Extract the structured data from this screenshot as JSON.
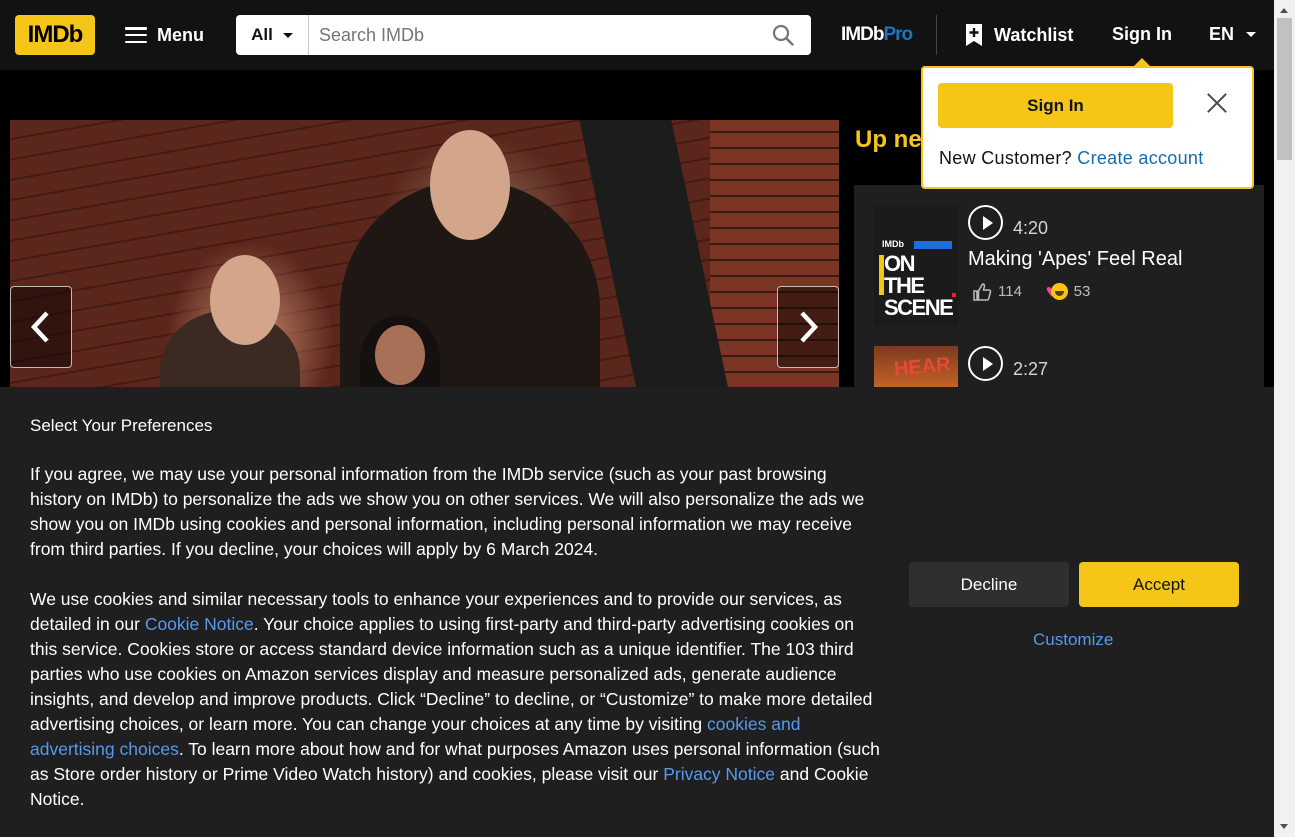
{
  "header": {
    "logo": "IMDb",
    "menu_label": "Menu",
    "search_category": "All",
    "search_placeholder": "Search IMDb",
    "imdbpro_a": "IMDb",
    "imdbpro_b": "Pro",
    "watchlist_label": "Watchlist",
    "signin_label": "Sign In",
    "language": "EN"
  },
  "upnext": {
    "title": "Up ne",
    "items": [
      {
        "duration": "4:20",
        "title": "Making 'Apes' Feel Real",
        "likes": "114",
        "reactions": "53",
        "thumb_tag": "IMDb",
        "thumb_text_1": "ON THE",
        "thumb_text_2": "SCENE"
      },
      {
        "duration": "2:27",
        "thumb_text": "HEAR"
      }
    ]
  },
  "popover": {
    "signin_button": "Sign In",
    "new_customer": "New Customer?",
    "create_account": "Create account"
  },
  "consent": {
    "title": "Select Your Preferences",
    "p1": "If you agree, we may use your personal information from the IMDb service (such as your past browsing history on IMDb) to personalize the ads we show you on other services. We will also personalize the ads we show you on IMDb using cookies and personal information, including personal information we may receive from third parties. If you decline, your choices will apply by 6 March 2024.",
    "p2_a": "We use cookies and similar necessary tools to enhance your experiences and to provide our services, as detailed in our ",
    "link_cookie_notice": "Cookie Notice",
    "p2_b": ". Your choice applies to using first-party and third-party advertising cookies on this service. Cookies store or access standard device information such as a unique identifier. The 103 third parties who use cookies on Amazon services display and measure personalized ads, generate audience insights, and develop and improve products. Click “Decline” to decline, or “Customize” to make more detailed advertising choices, or learn more. You can change your choices at any time by visiting ",
    "link_ad_choices": "cookies and advertising choices",
    "p2_c": ". To learn more about how and for what purposes Amazon uses personal information (such as Store order history or Prime Video Watch history) and cookies, please visit our ",
    "link_privacy": "Privacy Notice",
    "p2_d": " and Cookie Notice.",
    "decline_label": "Decline",
    "accept_label": "Accept",
    "customize_label": "Customize"
  },
  "colors": {
    "brand_yellow": "#f5c518",
    "link_blue": "#5799ef",
    "header_bg": "#121212",
    "panel_bg": "#1f1f1f"
  }
}
